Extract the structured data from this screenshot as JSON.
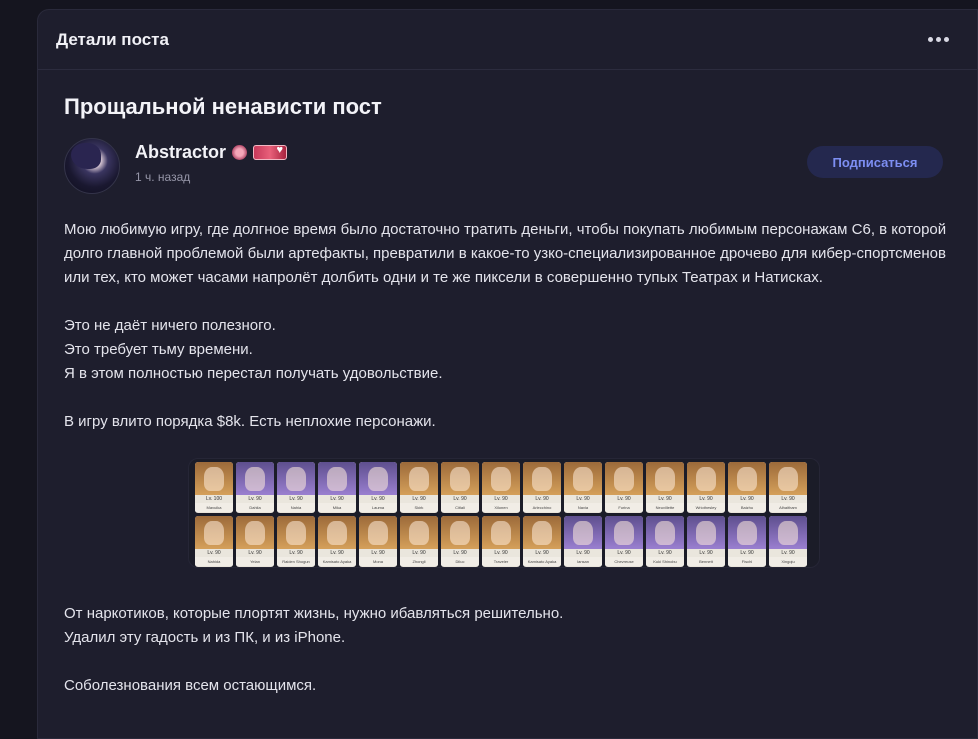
{
  "header": {
    "title": "Детали поста",
    "more_icon": "more-horizontal-icon"
  },
  "post": {
    "title": "Прощальной ненависти пост",
    "author": {
      "name": "Abstractor",
      "time": "1 ч. назад",
      "subscribe_label": "Подписаться"
    },
    "paragraphs": [
      "Мою любимую игру, где долгное время было достаточно тратить деньги, чтобы покупать любимым персонажам C6, в которой долго главной проблемой были артефакты, превратили в какое-то узко-специализированное дрочево для кибер-спортсменов или тех, кто может часами напролёт долбить одни и те же пиксели в совершенно тупых Театрах и Натисках."
    ],
    "lines_block_1": [
      "Это не даёт ничего полезного.",
      "Это требует тьму времени.",
      "Я в этом полностью перестал получать удовольствие."
    ],
    "money_line": "В игру влито порядка $8k. Есть неплохие персонажи.",
    "lines_block_2": [
      "От наркотиков, которые плортят жизнь, нужно ибавляться решительно.",
      "Удалил эту гадость и из ПК, и из iPhone."
    ],
    "closing": "Соболезнования всем остающимся."
  },
  "characters": {
    "row1": [
      {
        "lv": "Lv. 100",
        "name": "Mavuika",
        "rarity": 5
      },
      {
        "lv": "Lv. 90",
        "name": "Dahlia",
        "rarity": 4
      },
      {
        "lv": "Lv. 90",
        "name": "Nahia",
        "rarity": 4
      },
      {
        "lv": "Lv. 90",
        "name": "Mika",
        "rarity": 4
      },
      {
        "lv": "Lv. 90",
        "name": "Lauma",
        "rarity": 4
      },
      {
        "lv": "Lv. 90",
        "name": "Skirk",
        "rarity": 5
      },
      {
        "lv": "Lv. 90",
        "name": "Citlali",
        "rarity": 5
      },
      {
        "lv": "Lv. 90",
        "name": "Xilonen",
        "rarity": 5
      },
      {
        "lv": "Lv. 90",
        "name": "Arlecchino",
        "rarity": 5
      },
      {
        "lv": "Lv. 90",
        "name": "Navia",
        "rarity": 5
      },
      {
        "lv": "Lv. 90",
        "name": "Furina",
        "rarity": 5
      },
      {
        "lv": "Lv. 90",
        "name": "Neuvillette",
        "rarity": 5
      },
      {
        "lv": "Lv. 90",
        "name": "Wriothesley",
        "rarity": 5
      },
      {
        "lv": "Lv. 90",
        "name": "Baizhu",
        "rarity": 5
      },
      {
        "lv": "Lv. 90",
        "name": "Alhaitham",
        "rarity": 5
      }
    ],
    "row2": [
      {
        "lv": "Lv. 90",
        "name": "Nahida",
        "rarity": 5
      },
      {
        "lv": "Lv. 90",
        "name": "Yelan",
        "rarity": 5
      },
      {
        "lv": "Lv. 90",
        "name": "Raiden Shogun",
        "rarity": 5
      },
      {
        "lv": "Lv. 90",
        "name": "Kamisato Ayaka",
        "rarity": 5
      },
      {
        "lv": "Lv. 90",
        "name": "Mona",
        "rarity": 5
      },
      {
        "lv": "Lv. 90",
        "name": "Zhongli",
        "rarity": 5
      },
      {
        "lv": "Lv. 90",
        "name": "Diluc",
        "rarity": 5
      },
      {
        "lv": "Lv. 90",
        "name": "Traveler",
        "rarity": 5
      },
      {
        "lv": "Lv. 90",
        "name": "Kamisato Ayaka",
        "rarity": 5
      },
      {
        "lv": "Lv. 90",
        "name": "Iansan",
        "rarity": 4
      },
      {
        "lv": "Lv. 90",
        "name": "Chevreuse",
        "rarity": 4
      },
      {
        "lv": "Lv. 90",
        "name": "Kuki Shinobu",
        "rarity": 4
      },
      {
        "lv": "Lv. 90",
        "name": "Bennett",
        "rarity": 4
      },
      {
        "lv": "Lv. 90",
        "name": "Fischl",
        "rarity": 4
      },
      {
        "lv": "Lv. 90",
        "name": "Xingqiu",
        "rarity": 4
      }
    ]
  }
}
